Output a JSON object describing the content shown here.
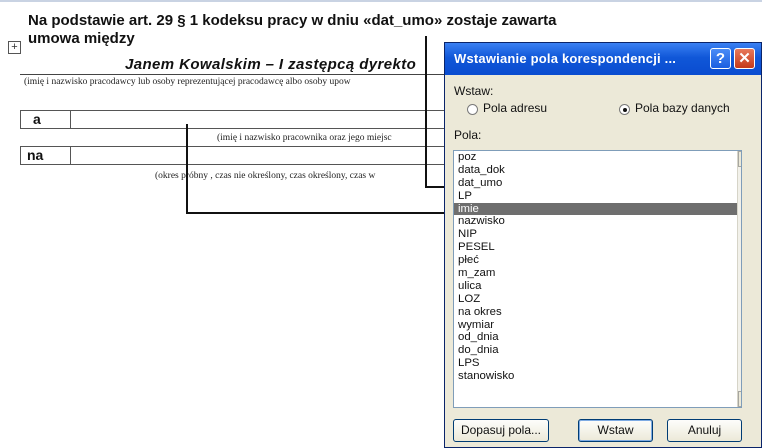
{
  "document": {
    "heading_line1": "Na podstawie art. 29 § 1 kodeksu pracy w dniu «dat_umo» zostaje zawarta",
    "heading_line2": "umowa między",
    "table_anchor_glyph": "+",
    "employer_name": "Janem  Kowalskim  – I zastępcą dyrekto",
    "employer_note": "(imię i nazwisko pracodawcy lub osoby reprezentującej pracodawcę albo osoby upow",
    "row_a_label": "a",
    "employee_note": "(imię i nazwisko pracownika oraz jego miejsc",
    "row_na_label": "na",
    "contract_note": "(okres próbny , czas nie określony, czas określony, czas w"
  },
  "dialog": {
    "title": "Wstawianie pola korespondencji ...",
    "help_glyph": "?",
    "close_glyph": "✕",
    "insert_label": "Wstaw:",
    "radio_address": "Pola adresu",
    "radio_database": "Pola bazy danych",
    "selected_radio": "Pola bazy danych",
    "fields_label": "Pola:",
    "fields": [
      "poz",
      "data_dok",
      "dat_umo",
      "LP",
      "imie",
      "nazwisko",
      "NIP",
      "PESEL",
      "płeć",
      "m_zam",
      "ulica",
      "LOZ",
      "na okres",
      "wymiar",
      "od_dnia",
      "do_dnia",
      "LPS",
      "stanowisko"
    ],
    "selected_field": "imie",
    "scroll_up_glyph": "▲",
    "scroll_down_glyph": "▼",
    "match_fields_button": "Dopasuj pola...",
    "insert_button": "Wstaw",
    "cancel_button": "Anuluj"
  }
}
